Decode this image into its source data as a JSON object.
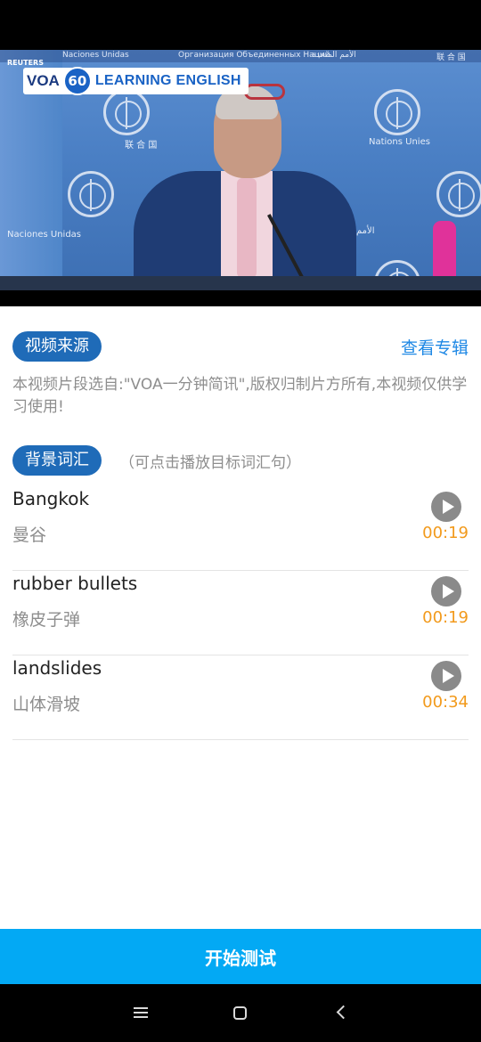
{
  "video": {
    "reuters": "REUTERS",
    "logo": {
      "voa": "VOA",
      "number": "60",
      "label": "LEARNING ENGLISH"
    },
    "lang_strip": [
      "Naciones Unidas",
      "Организация Объединенных Наций",
      "الأمم المتحدة",
      "联 合 国"
    ],
    "un_labels": [
      "联 合 国",
      "Nations Unies",
      "Naciones Unidas",
      "الأمم"
    ]
  },
  "source": {
    "label": "视频来源",
    "album_link": "查看专辑",
    "description": "本视频片段选自:\"VOA一分钟简讯\",版权归制片方所有,本视频仅供学习使用!"
  },
  "vocab": {
    "label": "背景词汇",
    "hint": "（可点击播放目标词汇句）",
    "items": [
      {
        "en": "Bangkok",
        "zh": "曼谷",
        "time": "00:19"
      },
      {
        "en": "rubber bullets",
        "zh": "橡皮子弹",
        "time": "00:19"
      },
      {
        "en": "landslides",
        "zh": "山体滑坡",
        "time": "00:34"
      }
    ]
  },
  "start_button": "开始测试",
  "icons": {
    "play": "play-icon",
    "nav_menu": "menu-icon",
    "nav_home": "home-icon",
    "nav_back": "back-icon"
  },
  "colors": {
    "pill": "#1f6bb8",
    "link": "#1e88e5",
    "time": "#f29a1c",
    "start_button": "#03a9f4"
  }
}
